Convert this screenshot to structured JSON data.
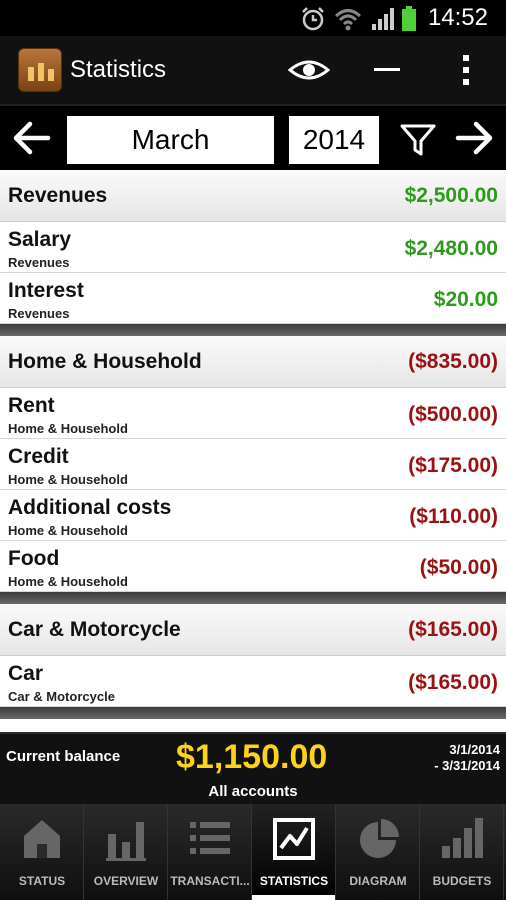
{
  "status_bar": {
    "time": "14:52"
  },
  "action_bar": {
    "title": "Statistics"
  },
  "nav": {
    "month": "March",
    "year": "2014"
  },
  "groups": [
    {
      "name": "Revenues",
      "amount": "$2,500.00",
      "type": "pos",
      "items": [
        {
          "name": "Salary",
          "category": "Revenues",
          "amount": "$2,480.00"
        },
        {
          "name": "Interest",
          "category": "Revenues",
          "amount": "$20.00"
        }
      ]
    },
    {
      "name": "Home & Household",
      "amount": "($835.00)",
      "type": "neg",
      "items": [
        {
          "name": "Rent",
          "category": "Home & Household",
          "amount": "($500.00)"
        },
        {
          "name": "Credit",
          "category": "Home & Household",
          "amount": "($175.00)"
        },
        {
          "name": "Additional costs",
          "category": "Home & Household",
          "amount": "($110.00)"
        },
        {
          "name": "Food",
          "category": "Home & Household",
          "amount": "($50.00)"
        }
      ]
    },
    {
      "name": "Car & Motorcycle",
      "amount": "($165.00)",
      "type": "neg",
      "items": [
        {
          "name": "Car",
          "category": "Car & Motorcycle",
          "amount": "($165.00)"
        }
      ]
    }
  ],
  "balance": {
    "label": "Current balance",
    "amount": "$1,150.00",
    "accounts": "All accounts",
    "date_from": "3/1/2014",
    "date_to": "- 3/31/2014"
  },
  "tabs": [
    {
      "label": "STATUS",
      "icon": "home-icon",
      "active": false
    },
    {
      "label": "OVERVIEW",
      "icon": "bar-chart-icon",
      "active": false
    },
    {
      "label": "TRANSACTI...",
      "icon": "list-icon",
      "active": false
    },
    {
      "label": "STATISTICS",
      "icon": "line-chart-icon",
      "active": true
    },
    {
      "label": "DIAGRAM",
      "icon": "pie-chart-icon",
      "active": false
    },
    {
      "label": "BUDGETS",
      "icon": "ascending-bars-icon",
      "active": false
    }
  ],
  "colors": {
    "positive": "#2e9a1c",
    "negative": "#9b1111",
    "balance": "#ffd21a"
  }
}
